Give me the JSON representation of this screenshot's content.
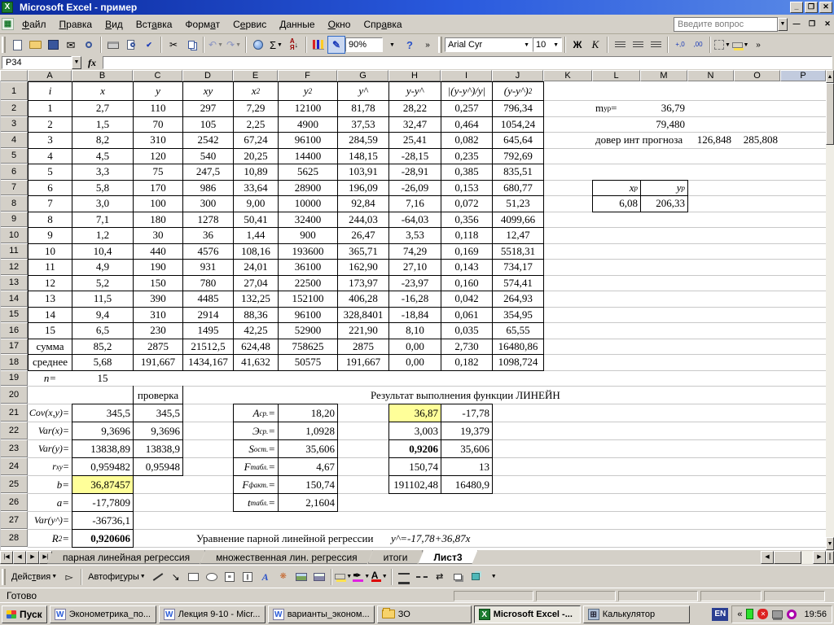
{
  "window": {
    "title": "Microsoft Excel - пример"
  },
  "menu_bar": {
    "items": [
      "<u>Ф</u>айл",
      "<u>П</u>равка",
      "<u>В</u>ид",
      "Вст<u>а</u>вка",
      "Форм<u>а</u>т",
      "С<u>е</u>рвис",
      "<u>Д</u>анные",
      "<u>О</u>кно",
      "Спр<u>а</u>вка"
    ],
    "question_placeholder": "Введите вопрос"
  },
  "standard_toolbar": {
    "zoom_value": "90%"
  },
  "formatting_toolbar": {
    "font_name": "Arial Cyr",
    "font_size": "10",
    "bold_label": "Ж",
    "italic_label": "К",
    "dec_inc": "+,0",
    "dec_dec": ",00"
  },
  "formula_bar": {
    "name_box": "P34",
    "fx_label": "fx"
  },
  "sheet": {
    "col_headers": [
      "A",
      "B",
      "C",
      "D",
      "E",
      "F",
      "G",
      "H",
      "I",
      "J",
      "K",
      "L",
      "M",
      "N",
      "O",
      "P"
    ],
    "selected_col": "P",
    "row_count": 28,
    "table": {
      "headers": [
        "i",
        "x",
        "y",
        "xy",
        "x<sup>2</sup>",
        "y<sup>2</sup>",
        "y^",
        "y-y^",
        "|(y-y^)/y|",
        "(y-y^)<sup>2</sup>"
      ],
      "rows": [
        [
          "1",
          "2,7",
          "110",
          "297",
          "7,29",
          "12100",
          "81,78",
          "28,22",
          "0,257",
          "796,34"
        ],
        [
          "2",
          "1,5",
          "70",
          "105",
          "2,25",
          "4900",
          "37,53",
          "32,47",
          "0,464",
          "1054,24"
        ],
        [
          "3",
          "8,2",
          "310",
          "2542",
          "67,24",
          "96100",
          "284,59",
          "25,41",
          "0,082",
          "645,64"
        ],
        [
          "4",
          "4,5",
          "120",
          "540",
          "20,25",
          "14400",
          "148,15",
          "-28,15",
          "0,235",
          "792,69"
        ],
        [
          "5",
          "3,3",
          "75",
          "247,5",
          "10,89",
          "5625",
          "103,91",
          "-28,91",
          "0,385",
          "835,51"
        ],
        [
          "6",
          "5,8",
          "170",
          "986",
          "33,64",
          "28900",
          "196,09",
          "-26,09",
          "0,153",
          "680,77"
        ],
        [
          "7",
          "3,0",
          "100",
          "300",
          "9,00",
          "10000",
          "92,84",
          "7,16",
          "0,072",
          "51,23"
        ],
        [
          "8",
          "7,1",
          "180",
          "1278",
          "50,41",
          "32400",
          "244,03",
          "-64,03",
          "0,356",
          "4099,66"
        ],
        [
          "9",
          "1,2",
          "30",
          "36",
          "1,44",
          "900",
          "26,47",
          "3,53",
          "0,118",
          "12,47"
        ],
        [
          "10",
          "10,4",
          "440",
          "4576",
          "108,16",
          "193600",
          "365,71",
          "74,29",
          "0,169",
          "5518,31"
        ],
        [
          "11",
          "4,9",
          "190",
          "931",
          "24,01",
          "36100",
          "162,90",
          "27,10",
          "0,143",
          "734,17"
        ],
        [
          "12",
          "5,2",
          "150",
          "780",
          "27,04",
          "22500",
          "173,97",
          "-23,97",
          "0,160",
          "574,41"
        ],
        [
          "13",
          "11,5",
          "390",
          "4485",
          "132,25",
          "152100",
          "406,28",
          "-16,28",
          "0,042",
          "264,93"
        ],
        [
          "14",
          "9,4",
          "310",
          "2914",
          "88,36",
          "96100",
          "328,8401",
          "-18,84",
          "0,061",
          "354,95"
        ],
        [
          "15",
          "6,5",
          "230",
          "1495",
          "42,25",
          "52900",
          "221,90",
          "8,10",
          "0,035",
          "65,55"
        ],
        [
          "сумма",
          "85,2",
          "2875",
          "21512,5",
          "624,48",
          "758625",
          "2875",
          "0,00",
          "2,730",
          "16480,86"
        ],
        [
          "среднее",
          "5,68",
          "191,667",
          "1434,167",
          "41,632",
          "50575",
          "191,667",
          "0,00",
          "0,182",
          "1098,724"
        ]
      ]
    },
    "cells": [
      {
        "c": "A",
        "r": 19,
        "t": "n=",
        "cls": "it"
      },
      {
        "c": "B",
        "r": 19,
        "t": "15"
      },
      {
        "c": "C",
        "r": 20,
        "t": "проверка"
      },
      {
        "c": "G",
        "r": 20,
        "c2": "L",
        "t": "Результат выполнения функции ЛИНЕЙН",
        "cls": "l wbg",
        "pad": 40
      },
      {
        "c": "A",
        "r": 21,
        "t": "Cov(x,y)=",
        "cls": "it r lbl"
      },
      {
        "c": "B",
        "r": 21,
        "t": "345,5",
        "cls": "r"
      },
      {
        "c": "C",
        "r": 21,
        "t": "345,5",
        "cls": "r"
      },
      {
        "c": "A",
        "r": 22,
        "t": "Var(x)=",
        "cls": "it r lbl"
      },
      {
        "c": "B",
        "r": 22,
        "t": "9,3696",
        "cls": "r"
      },
      {
        "c": "C",
        "r": 22,
        "t": "9,3696",
        "cls": "r"
      },
      {
        "c": "A",
        "r": 23,
        "t": "Var(y)=",
        "cls": "it r lbl"
      },
      {
        "c": "B",
        "r": 23,
        "t": "13838,89",
        "cls": "r"
      },
      {
        "c": "C",
        "r": 23,
        "t": "13838,9",
        "cls": "r"
      },
      {
        "c": "A",
        "r": 24,
        "t": "r<sub>ху</sub>=",
        "cls": "it r lbl"
      },
      {
        "c": "B",
        "r": 24,
        "t": "0,959482",
        "cls": "r"
      },
      {
        "c": "C",
        "r": 24,
        "t": "0,95948",
        "cls": "r"
      },
      {
        "c": "A",
        "r": 25,
        "t": "b=",
        "cls": "it r"
      },
      {
        "c": "B",
        "r": 25,
        "t": "36,87457",
        "cls": "r yellow"
      },
      {
        "c": "A",
        "r": 26,
        "t": "a=",
        "cls": "it r"
      },
      {
        "c": "B",
        "r": 26,
        "t": "-17,7809",
        "cls": "r"
      },
      {
        "c": "A",
        "r": 27,
        "t": "Var(y^)=",
        "cls": "it r lbl"
      },
      {
        "c": "B",
        "r": 27,
        "t": "-36736,1",
        "cls": "r"
      },
      {
        "c": "A",
        "r": 28,
        "t": "R<sup>2</sup>=",
        "cls": "it r"
      },
      {
        "c": "B",
        "r": 28,
        "t": "0,920606",
        "cls": "r b"
      },
      {
        "c": "D",
        "r": 28,
        "c2": "G",
        "t": "Уравнение парной линейной регрессии",
        "cls": "l wbg",
        "pad": 16
      },
      {
        "c": "H",
        "r": 28,
        "c2": "J",
        "t": "y^=-17,78+36,87x",
        "cls": "l it wbg",
        "pad": 2
      },
      {
        "c": "E",
        "r": 21,
        "t": "A<sub>ср.</sub>=",
        "cls": "it r"
      },
      {
        "c": "F",
        "r": 21,
        "t": "18,20",
        "cls": "r"
      },
      {
        "c": "E",
        "r": 22,
        "t": "Э<sub>ср.</sub>=",
        "cls": "it r"
      },
      {
        "c": "F",
        "r": 22,
        "t": "1,0928",
        "cls": "r"
      },
      {
        "c": "E",
        "r": 23,
        "t": "S<sub>ост.</sub>=",
        "cls": "it r"
      },
      {
        "c": "F",
        "r": 23,
        "t": "35,606",
        "cls": "r"
      },
      {
        "c": "E",
        "r": 24,
        "t": "F<sub>табл.</sub>=",
        "cls": "it r"
      },
      {
        "c": "F",
        "r": 24,
        "t": "4,67",
        "cls": "r"
      },
      {
        "c": "E",
        "r": 25,
        "t": "F<sub>факт.</sub>=",
        "cls": "it r"
      },
      {
        "c": "F",
        "r": 25,
        "t": "150,74",
        "cls": "r"
      },
      {
        "c": "E",
        "r": 26,
        "t": "t<sub>табл.</sub>=",
        "cls": "it r"
      },
      {
        "c": "F",
        "r": 26,
        "t": "2,1604",
        "cls": "r"
      },
      {
        "c": "H",
        "r": 21,
        "t": "36,87",
        "cls": "r yellow"
      },
      {
        "c": "I",
        "r": 21,
        "t": "-17,78",
        "cls": "r"
      },
      {
        "c": "H",
        "r": 22,
        "t": "3,003",
        "cls": "r"
      },
      {
        "c": "I",
        "r": 22,
        "t": "19,379",
        "cls": "r"
      },
      {
        "c": "H",
        "r": 23,
        "t": "0,9206",
        "cls": "r b"
      },
      {
        "c": "I",
        "r": 23,
        "t": "35,606",
        "cls": "r"
      },
      {
        "c": "H",
        "r": 24,
        "t": "150,74",
        "cls": "r"
      },
      {
        "c": "I",
        "r": 24,
        "t": "13",
        "cls": "r"
      },
      {
        "c": "H",
        "r": 25,
        "t": "191102,48",
        "cls": "r"
      },
      {
        "c": "I",
        "r": 25,
        "t": "16480,9",
        "cls": "r"
      },
      {
        "c": "L",
        "r": 2,
        "t": "m<sub>ур</sub>=",
        "cls": "l"
      },
      {
        "c": "M",
        "r": 2,
        "t": "36,79",
        "cls": "r"
      },
      {
        "c": "M",
        "r": 3,
        "t": "79,480",
        "cls": "r"
      },
      {
        "c": "L",
        "r": 4,
        "c2": "M",
        "t": "довер инт прогноза",
        "cls": "l wbg",
        "pad": 3
      },
      {
        "c": "N",
        "r": 4,
        "t": "126,848",
        "cls": "r"
      },
      {
        "c": "O",
        "r": 4,
        "t": "285,808",
        "cls": "r"
      },
      {
        "c": "L",
        "r": 7,
        "t": "x<sub>р</sub>",
        "cls": "it r",
        "pad": 6
      },
      {
        "c": "M",
        "r": 7,
        "t": "y<sub>р</sub>",
        "cls": "it r",
        "pad": 6
      },
      {
        "c": "L",
        "r": 8,
        "t": "6,08",
        "cls": "r"
      },
      {
        "c": "M",
        "r": 8,
        "t": "206,33",
        "cls": "r"
      }
    ]
  },
  "sheet_tabs": {
    "tabs": [
      {
        "label": "парная линейная регрессия",
        "active": false
      },
      {
        "label": "множественная лин. регрессия",
        "active": false
      },
      {
        "label": "итоги",
        "active": false
      },
      {
        "label": "Лист3",
        "active": true
      }
    ]
  },
  "drawing_toolbar": {
    "actions_label": "Дейс<u>т</u>вия",
    "autoshapes_label": "Автофи<u>г</u>уры"
  },
  "status_bar": {
    "message": "Готово"
  },
  "taskbar": {
    "start_label": "Пуск",
    "buttons": [
      {
        "label": "Эконометрика_по...",
        "icon": "word",
        "active": false
      },
      {
        "label": "Лекция 9-10 - Micr...",
        "icon": "word",
        "active": false
      },
      {
        "label": "варианты_эконом...",
        "icon": "word",
        "active": false
      },
      {
        "label": "ЗО",
        "icon": "folder",
        "active": false
      },
      {
        "label": "Microsoft Excel -...",
        "icon": "excel",
        "active": true
      },
      {
        "label": "Калькулятор",
        "icon": "calc",
        "active": false
      }
    ],
    "tray": {
      "language": "EN",
      "chevron": "«",
      "clock": "19:56"
    }
  },
  "colors": {
    "accent_yellow": "#ffff99",
    "gridline": "#c8c8c8"
  }
}
